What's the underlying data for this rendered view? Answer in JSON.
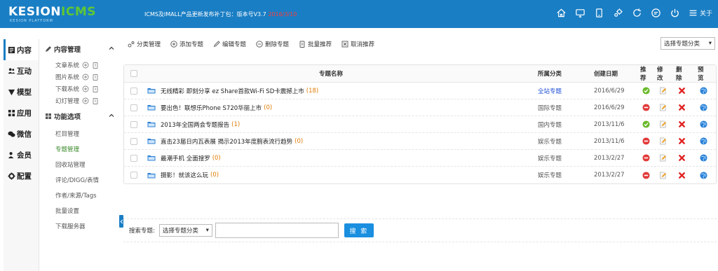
{
  "header": {
    "logo_main": "KESION",
    "logo_accent": "ICMS",
    "logo_sub": "KESION PLATFORM",
    "notice_text": "ICMS及IMALL产品更新发布补丁包：版本号V3.7 ",
    "notice_date": "2016/3/10",
    "about_label": "关于",
    "icons": [
      "home-icon",
      "monitor-icon",
      "mobile-icon",
      "settings-icon",
      "refresh-icon",
      "message-icon",
      "power-icon",
      "menu-icon"
    ]
  },
  "sidebar": {
    "items": [
      {
        "label": "内容",
        "icon": "doc-icon"
      },
      {
        "label": "互动",
        "icon": "users-icon"
      },
      {
        "label": "模型",
        "icon": "model-icon"
      },
      {
        "label": "应用",
        "icon": "apps-icon"
      },
      {
        "label": "微信",
        "icon": "wechat-icon"
      },
      {
        "label": "会员",
        "icon": "member-icon"
      },
      {
        "label": "配置",
        "icon": "config-icon"
      }
    ]
  },
  "submenu": {
    "group1_title": "内容管理",
    "group1_items": [
      "文章系统",
      "图片系统",
      "下载系统",
      "幻灯管理"
    ],
    "group2_title": "功能选项",
    "group2_items": [
      "栏目管理",
      "专题管理",
      "回收站管理",
      "评论/DIGG/表情",
      "作者/来源/Tags",
      "批量设置",
      "下载服务器"
    ]
  },
  "toolbar": {
    "buttons": [
      "分类管理",
      "添加专题",
      "编辑专题",
      "删除专题",
      "批量推荐",
      "取消推荐"
    ],
    "category_select": "选择专题分类"
  },
  "table": {
    "headers": {
      "name": "专题名称",
      "category": "所属分类",
      "date": "创建日期",
      "recommend": "推荐",
      "edit": "修改",
      "delete": "删除",
      "preview": "预览"
    },
    "rows": [
      {
        "name": "无线精彩 即刻分享 ez Share首款Wi-Fi SD卡震撼上市",
        "count": "(18)",
        "category": "全站专题",
        "date": "2016/6/29",
        "recommended": "yes"
      },
      {
        "name": "要出色！联想乐Phone S720华丽上市",
        "count": "(0)",
        "category": "国际专题",
        "date": "2016/6/29",
        "recommended": "no"
      },
      {
        "name": "2013年全国两会专题报告",
        "count": "(1)",
        "category": "国内专题",
        "date": "2013/11/6",
        "recommended": "yes"
      },
      {
        "name": "直击23届日内瓦表展 揭示2013年度腕表流行趋势",
        "count": "(0)",
        "category": "娱乐专题",
        "date": "2013/11/6",
        "recommended": "no"
      },
      {
        "name": "最潮手机 全面搜罗",
        "count": "(0)",
        "category": "娱乐专题",
        "date": "2013/2/27",
        "recommended": "no"
      },
      {
        "name": "摄影！就该这么玩",
        "count": "(0)",
        "category": "娱乐专题",
        "date": "2013/2/27",
        "recommended": "no"
      }
    ]
  },
  "search": {
    "label": "搜索专题:",
    "select": "选择专题分类",
    "input_value": "",
    "button": "搜 索"
  },
  "colors": {
    "topbar": "#1a7ec4",
    "accent_green": "#5fc834",
    "notice_date": "#ff3b3b",
    "count": "#e07a00",
    "search_button": "#1a8fe0"
  }
}
